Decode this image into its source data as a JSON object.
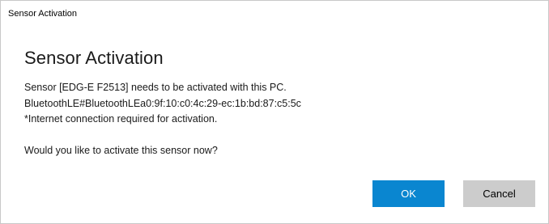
{
  "window": {
    "title": "Sensor Activation"
  },
  "dialog": {
    "heading": "Sensor Activation",
    "lines": [
      "Sensor [EDG-E F2513] needs to be activated with this PC.",
      "BluetoothLE#BluetoothLEa0:9f:10:c0:4c:29-ec:1b:bd:87:c5:5c",
      "*Internet connection required for activation."
    ],
    "question": "Would you like to activate this sensor now?"
  },
  "buttons": {
    "ok_label": "OK",
    "cancel_label": "Cancel"
  },
  "colors": {
    "accent": "#0a86d0",
    "cancel_bg": "#cccccc"
  }
}
